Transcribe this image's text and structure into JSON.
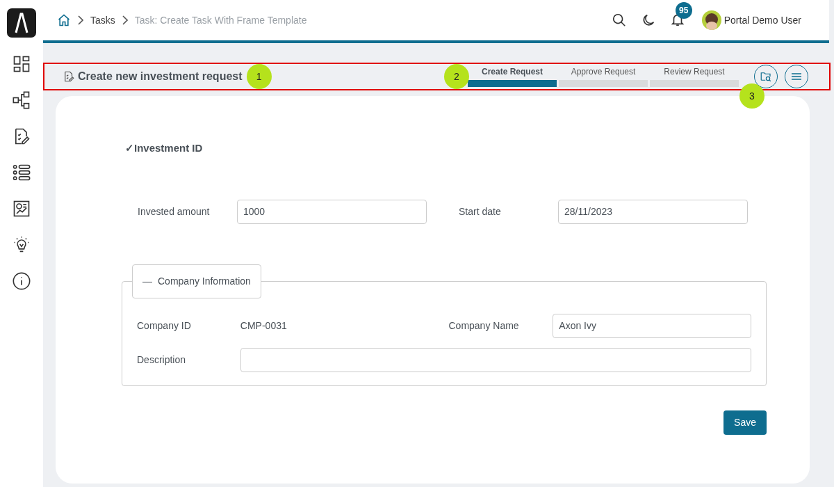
{
  "sidebar": {
    "items": [
      {
        "kind": "dashboard"
      },
      {
        "kind": "process"
      },
      {
        "kind": "tasks"
      },
      {
        "kind": "cases"
      },
      {
        "kind": "statistics"
      },
      {
        "kind": "ideas"
      },
      {
        "kind": "info"
      }
    ]
  },
  "breadcrumb": [
    "Tasks",
    "Task: Create Task With Frame Template"
  ],
  "header": {
    "notifications": "95",
    "user": "Portal Demo User"
  },
  "task_bar": {
    "title": "Create new investment request",
    "steps": [
      {
        "label": "Create Request",
        "selected": true
      },
      {
        "label": "Approve Request",
        "selected": false
      },
      {
        "label": "Review Request",
        "selected": false
      }
    ]
  },
  "annotations": [
    "1",
    "2",
    "3"
  ],
  "form": {
    "heading_mark": "✓",
    "heading": "Investment ID",
    "fields": [
      {
        "label": "Invested amount",
        "value": "1000"
      },
      {
        "label": "Start date",
        "value": "28/11/2023"
      }
    ],
    "panel": {
      "toggle": "—",
      "title": "Company Information",
      "expanded": true,
      "company_id_label": "Company ID",
      "company_id": "CMP-0031",
      "company_name_label": "Company Name",
      "company_name": "Axon Ivy",
      "description_label": "Description"
    },
    "save": "Save"
  }
}
